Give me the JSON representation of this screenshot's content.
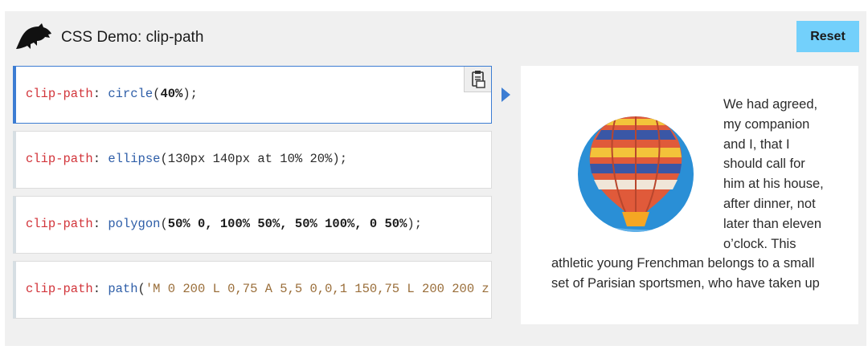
{
  "header": {
    "title": "CSS Demo: clip-path",
    "reset_label": "Reset"
  },
  "choices": [
    {
      "property": "clip-path",
      "colon": ": ",
      "function": "circle",
      "args": "40%",
      "close": ");",
      "selected": true
    },
    {
      "property": "clip-path",
      "colon": ": ",
      "function": "ellipse",
      "args_pre": "130px 140px at 10% 20%",
      "close": ");"
    },
    {
      "property": "clip-path",
      "colon": ": ",
      "function": "polygon",
      "args": "50% 0, 100% 50%, 50% 100%, 0 50%",
      "close": ");"
    },
    {
      "property": "clip-path",
      "colon": ": ",
      "function": "path",
      "args": "'M 0 200 L 0,75 A 5,5 0,0,1 150,75 L 200 200 z'",
      "close": ");"
    }
  ],
  "icons": {
    "copy": "clipboard-icon",
    "logo": "dinosaur-logo-icon",
    "run_indicator": "play-arrow-icon"
  },
  "output": {
    "text": "We had agreed, my companion and I, that I should call for him at his house, after dinner, not later than eleven o’clock. This athletic young Frenchman belongs to a small set of Parisian sportsmen, who have taken up"
  },
  "colors": {
    "reset_button": "#73d0fb",
    "selected_border": "#3c7dd3",
    "property": "#d2343a",
    "function": "#2e5ea8"
  }
}
